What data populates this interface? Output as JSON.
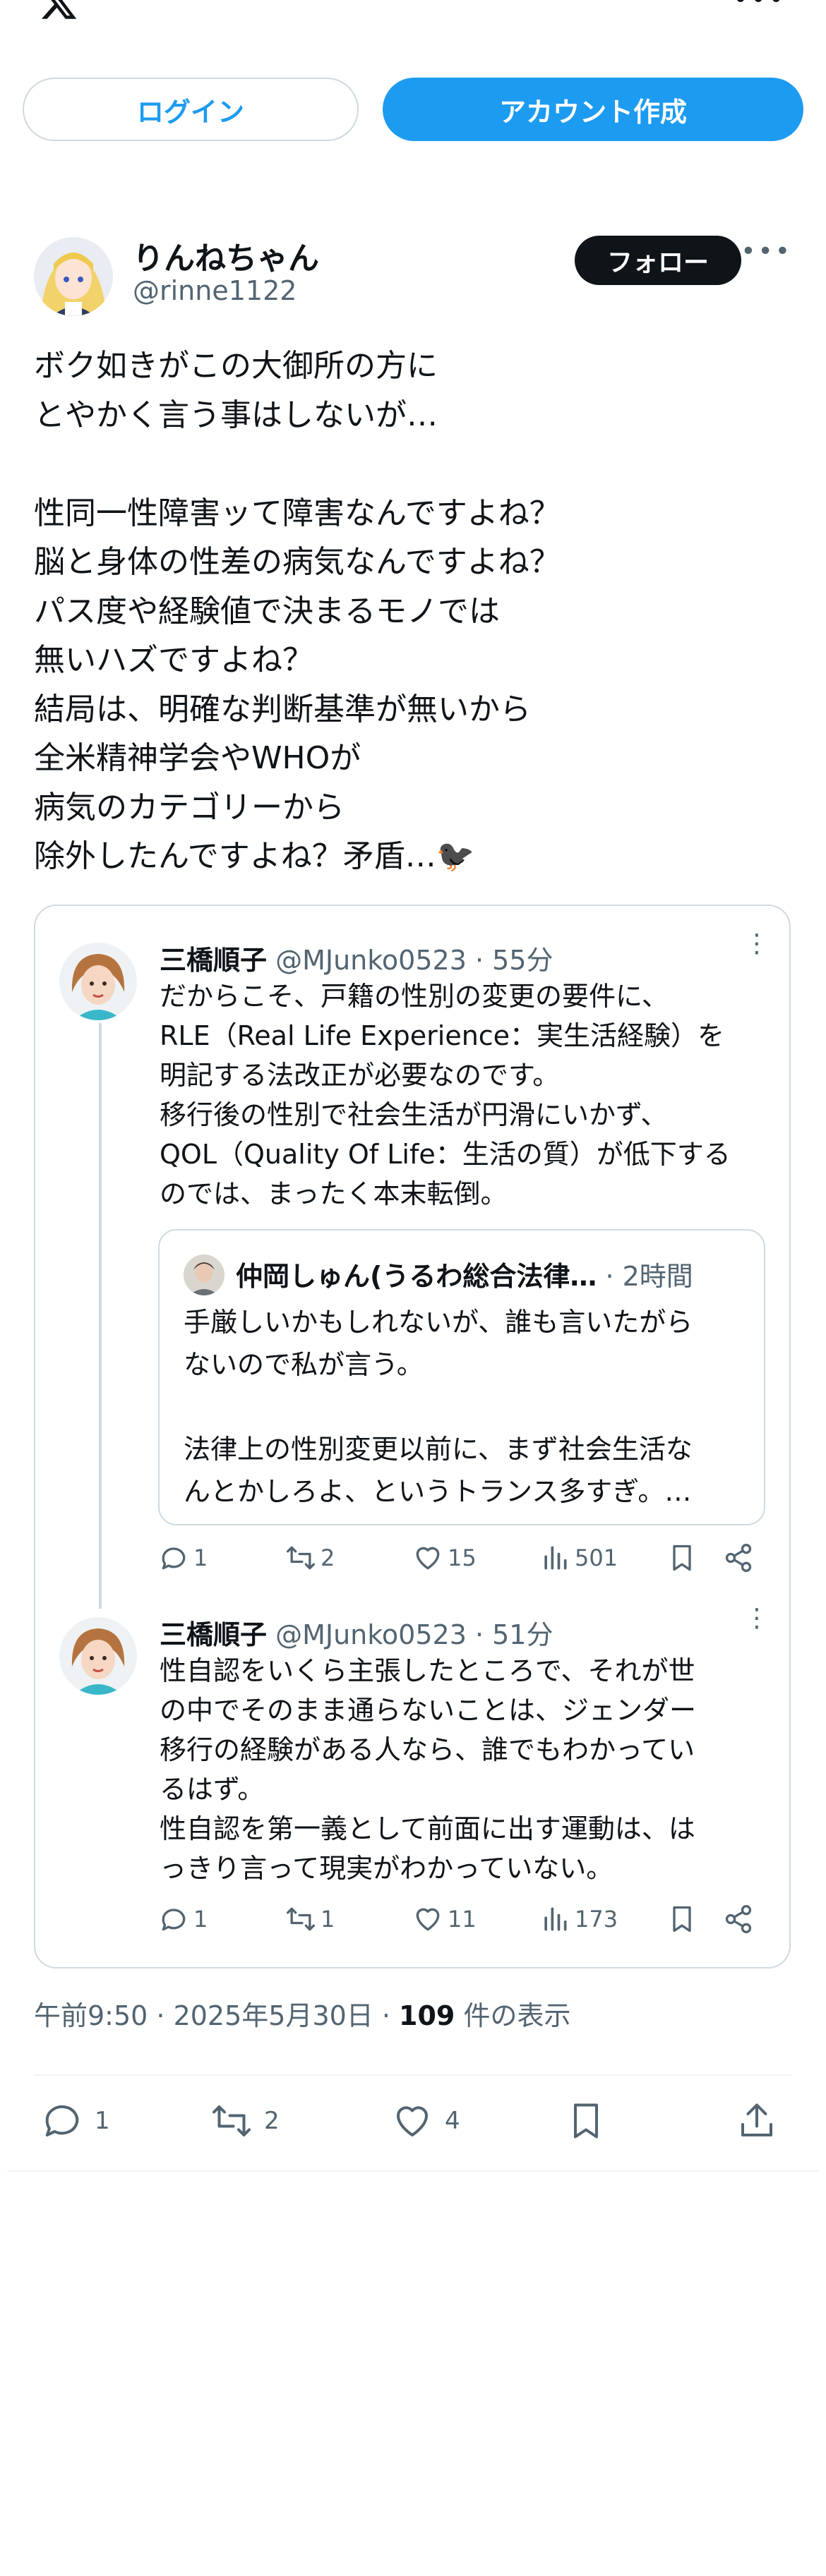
{
  "colors": {
    "accent": "#1d9bf0",
    "text": "#0f1419",
    "secondary": "#536471",
    "border": "#cfd9de"
  },
  "auth": {
    "login_label": "ログイン",
    "create_label": "アカウント作成"
  },
  "author": {
    "name": "りんねちゃん",
    "handle": "@rinne1122",
    "follow_label": "フォロー"
  },
  "tweet": {
    "lines": [
      "ボク如きがこの大御所の方に",
      "とやかく言う事はしないが…",
      "",
      "性同一性障害ッて障害なんですよね？",
      "脳と身体の性差の病気なんですよね？",
      "パス度や経験値で決まるモノでは",
      "無いハズですよね？",
      "結局は、明確な判断基準が無いから",
      "全米精神学会やWHOが",
      "病気のカテゴリーから",
      "除外したんですよね？矛盾…🐦‍⬛"
    ]
  },
  "quoted": [
    {
      "name": "三橋順子",
      "meta": "@MJunko0523 · 55分",
      "lines": [
        "だからこそ、戸籍の性別の変更の要件に、",
        "RLE（Real Life Experience：実生活経験）を",
        "明記する法改正が必要なのです。",
        "移行後の性別で社会生活が円滑にいかず、",
        "QOL（Quality Of Life：生活の質）が低下する",
        "のでは、まったく本末転倒。"
      ],
      "nested": {
        "name": "仲岡しゅん(うるわ総合法律…",
        "meta": " · 2時間",
        "lines": [
          "手厳しいかもしれないが、誰も言いたがら",
          "ないので私が言う。",
          "",
          "法律上の性別変更以前に、まず社会生活な",
          "んとかしろよ、というトランス多すぎ。…"
        ]
      },
      "stats": {
        "replies": "1",
        "retweets": "2",
        "likes": "15",
        "views": "501"
      }
    },
    {
      "name": "三橋順子",
      "meta": "@MJunko0523 · 51分",
      "lines": [
        "性自認をいくら主張したところで、それが世",
        "の中でそのまま通らないことは、ジェンダー",
        "移行の経験がある人なら、誰でもわかってい",
        "るはず。",
        "性自認を第一義として前面に出す運動は、は",
        "っきり言って現実がわかっていない。"
      ],
      "stats": {
        "replies": "1",
        "retweets": "1",
        "likes": "11",
        "views": "173"
      }
    }
  ],
  "meta": {
    "time": "午前9:50 · 2025年5月30日 · ",
    "views_count": "109",
    "views_label": " 件の表示"
  },
  "engagement": {
    "replies": "1",
    "retweets": "2",
    "likes": "4"
  }
}
